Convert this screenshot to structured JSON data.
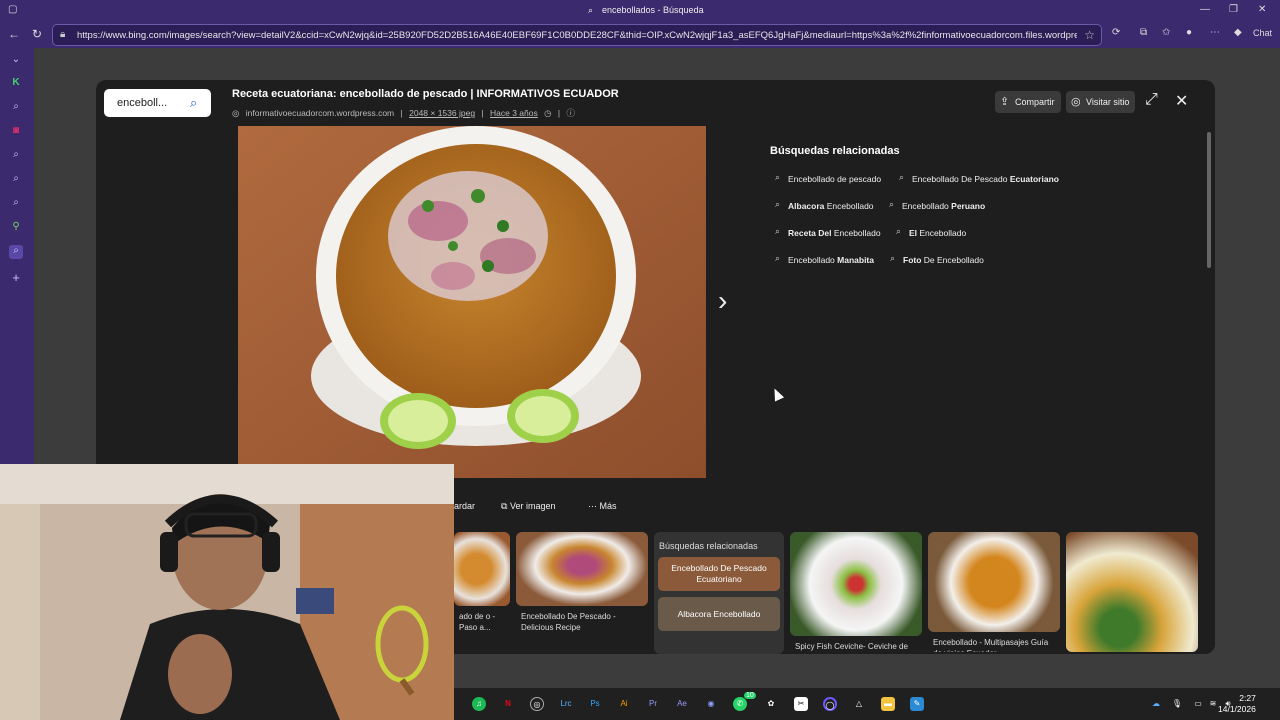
{
  "browser": {
    "window_title": "encebollados - Búsqueda",
    "url": "https://www.bing.com/images/search?view=detailV2&ccid=xCwN2wjq&id=25B920FD52D2B516A46E40EBF69F1C0B0DDE28CF&thid=OIP.xCwN2wjqjF1a3_asEFQ6JgHaFj&mediaurl=https%3a%2f%2finformativoecuadorcom.files.wordpress.co...",
    "chat_label": "Chat"
  },
  "modal": {
    "search_query": "enceboll...",
    "title": "Receta ecuatoriana: encebollado de pescado | INFORMATIVOS ECUADOR",
    "source": "informativoecuadorcom.wordpress.com",
    "dimensions": "2048 × 1536 jpeg",
    "age": "Hace 3 años",
    "share_label": "Compartir",
    "visit_label": "Visitar sitio",
    "related_title": "Búsquedas relacionadas",
    "related": [
      {
        "pre": "Encebollado de pescado",
        "bold": ""
      },
      {
        "pre": "Encebollado De Pescado ",
        "bold": "Ecuatoriano"
      },
      {
        "bold": "Albacora",
        "post": " Encebollado"
      },
      {
        "pre": "Encebollado ",
        "bold": "Peruano"
      },
      {
        "bold": "Receta Del",
        "post": " Encebollado"
      },
      {
        "bold": "El",
        "post": " Encebollado"
      },
      {
        "pre": "Encebollado ",
        "bold": "Manabita"
      },
      {
        "bold": "Foto",
        "post": " De Encebollado"
      }
    ],
    "actions": {
      "save": "ardar",
      "view": "Ver imagen",
      "more": "Más"
    },
    "thumbs": [
      {
        "caption": "ado de o - Paso a..."
      },
      {
        "caption": "Encebollado De Pescado - Delicious Recipe"
      },
      {
        "caption": "Spicy Fish Ceviche- Ceviche de"
      },
      {
        "caption": "Encebollado - Multipasajes Guía de viajes Ecuador"
      }
    ],
    "related_box": {
      "title": "Búsquedas relacionadas",
      "item1": "Encebollado De Pescado Ecuatoriano",
      "item2": "Albacora Encebollado"
    }
  },
  "taskbar": {
    "time": "2:27",
    "date": "14/1/2026",
    "whatsapp_badge": "10"
  }
}
